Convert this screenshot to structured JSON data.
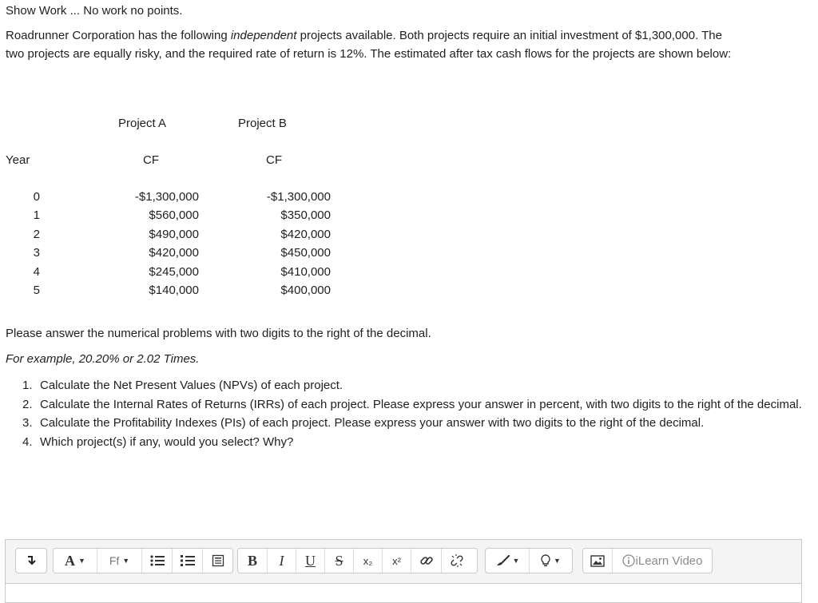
{
  "header": {
    "show_work": "Show Work ... No work no points.",
    "intro_line1_pre": "Roadrunner Corporation has the following ",
    "intro_line1_em": "independent",
    "intro_line1_post": "  projects available.  Both projects require an initial investment of $1,300,000. The",
    "intro_line2": "two projects are equally risky, and the required rate of return is 12%.  The estimated after tax cash flows for the projects are shown below:"
  },
  "table": {
    "project_a": "Project A",
    "project_b": "Project B",
    "year_label": "Year",
    "cf_a": "CF",
    "cf_b": "CF",
    "years": [
      "0",
      "1",
      "2",
      "3",
      "4",
      "5"
    ],
    "a_values": [
      "-$1,300,000",
      "$560,000",
      "$490,000",
      "$420,000",
      "$245,000",
      "$140,000"
    ],
    "b_values": [
      "-$1,300,000",
      "$350,000",
      "$420,000",
      "$450,000",
      "$410,000",
      "$400,000"
    ]
  },
  "instructions": {
    "line": "Please answer the numerical problems with two digits to the right of the decimal.",
    "example": "For example, 20.20% or 2.02 Times."
  },
  "questions": [
    {
      "num": "1.",
      "text": "Calculate the Net Present Values (NPVs) of each project."
    },
    {
      "num": "2.",
      "text": "Calculate the Internal Rates of Returns (IRRs) of each project.  Please express your answer in percent, with two digits to the right of the decimal."
    },
    {
      "num": "3.",
      "text": "Calculate the Profitability Indexes (PIs) of each project.  Please express your answer with two digits to the right of the decimal."
    },
    {
      "num": "4.",
      "text": "Which project(s) if any, would you select?  Why?"
    }
  ],
  "toolbar": {
    "font_color_label": "A",
    "font_family_label": "Ff",
    "bold_label": "B",
    "italic_label": "I",
    "underline_label": "U",
    "strike_label": "S",
    "subscript_label": "x₂",
    "superscript_label": "x²",
    "ilearn_label": "iLearn Video"
  }
}
